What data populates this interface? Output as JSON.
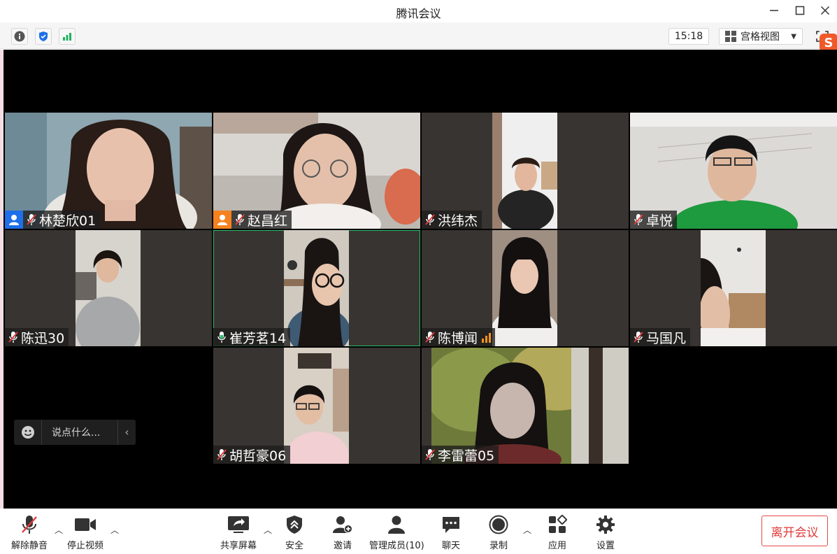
{
  "window": {
    "title": "腾讯会议"
  },
  "topbar": {
    "time": "15:18",
    "view_mode": "宫格视图"
  },
  "icons": {
    "info": "info-icon",
    "security": "shield-icon",
    "network": "signal-icon",
    "fullscreen": "fullscreen-icon",
    "ime": "sogou-icon"
  },
  "participants": [
    {
      "name": "林楚欣01",
      "role": "host",
      "mic": "muted"
    },
    {
      "name": "赵昌红",
      "role": "cohost",
      "mic": "muted"
    },
    {
      "name": "洪纬杰",
      "role": "",
      "mic": "muted"
    },
    {
      "name": "卓悦",
      "role": "",
      "mic": "muted"
    },
    {
      "name": "陈迅30",
      "role": "",
      "mic": "muted"
    },
    {
      "name": "崔芳茗14",
      "role": "",
      "mic": "on",
      "active": true
    },
    {
      "name": "陈博闻",
      "role": "",
      "mic": "muted",
      "signal": "weak"
    },
    {
      "name": "马国凡",
      "role": "",
      "mic": "muted"
    },
    {
      "name": "胡哲豪06",
      "role": "",
      "mic": "muted"
    },
    {
      "name": "李雷蕾05",
      "role": "",
      "mic": "muted"
    }
  ],
  "chat": {
    "placeholder": "说点什么..."
  },
  "controls": {
    "unmute": "解除静音",
    "stop_video": "停止视频",
    "share_screen": "共享屏幕",
    "security": "安全",
    "invite": "邀请",
    "manage_members": "管理成员(10)",
    "chat": "聊天",
    "record": "录制",
    "apps": "应用",
    "settings": "设置",
    "leave": "离开会议"
  },
  "colors": {
    "host_badge": "#1e6fe8",
    "cohost_badge": "#f5821f",
    "active_border": "#23c168",
    "leave_red": "#e03a3a",
    "tile_bg": "#383431"
  }
}
